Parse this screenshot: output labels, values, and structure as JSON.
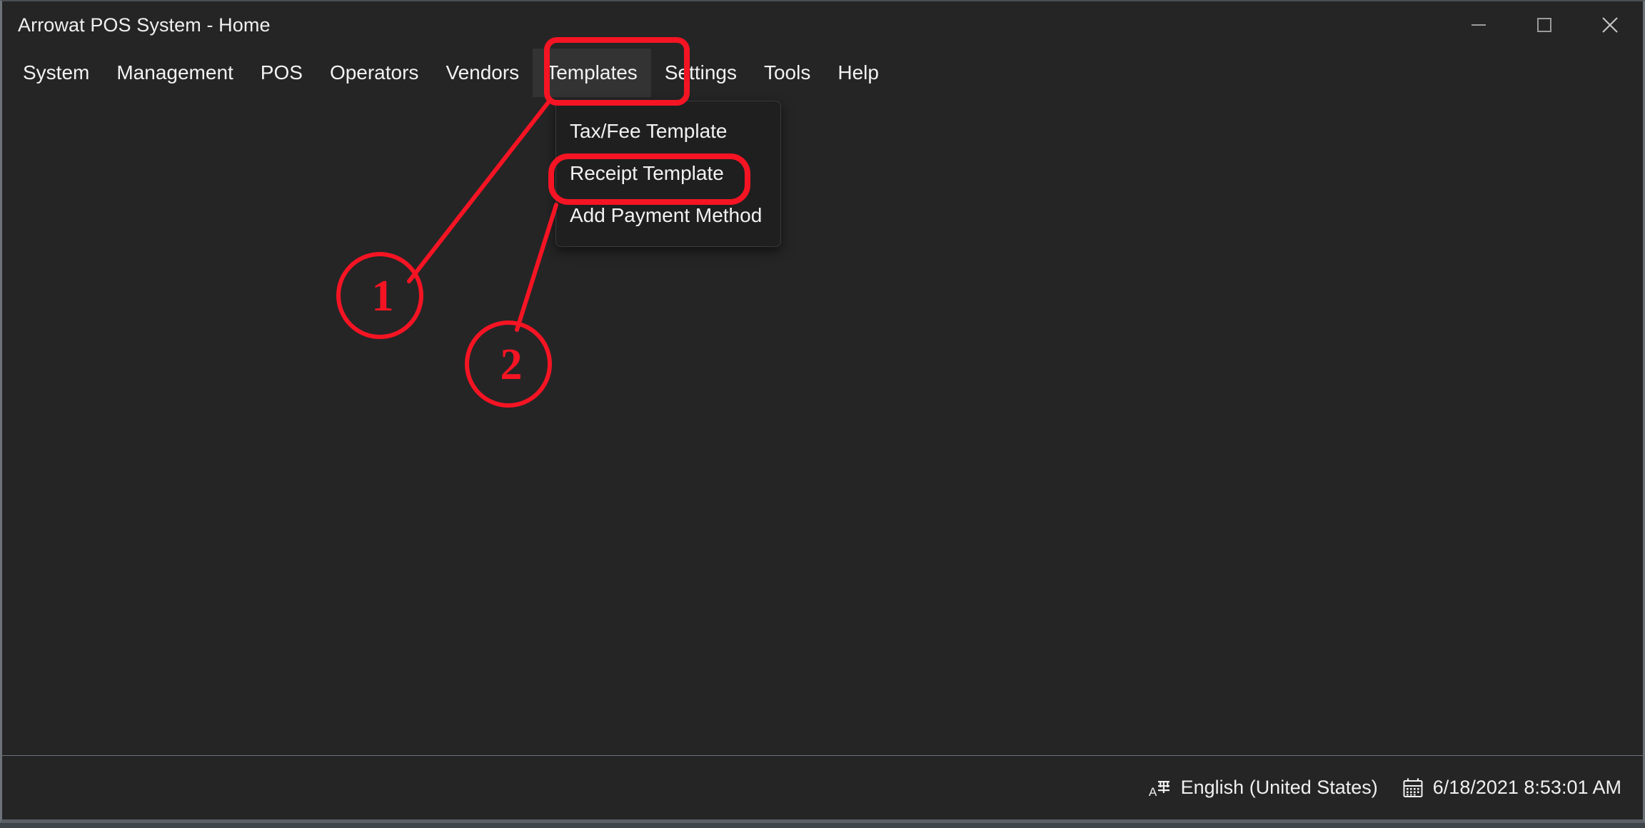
{
  "window": {
    "title": "Arrowat POS System - Home",
    "controls": [
      {
        "name": "minimize",
        "label": "Minimize"
      },
      {
        "name": "maximize",
        "label": "Maximize"
      },
      {
        "name": "close",
        "label": "Close"
      }
    ]
  },
  "menu_bar": {
    "items": [
      {
        "label": "System",
        "active": false
      },
      {
        "label": "Management",
        "active": false
      },
      {
        "label": "POS",
        "active": false
      },
      {
        "label": "Operators",
        "active": false
      },
      {
        "label": "Vendors",
        "active": false
      },
      {
        "label": "Templates",
        "active": true
      },
      {
        "label": "Settings",
        "active": false
      },
      {
        "label": "Tools",
        "active": false
      },
      {
        "label": "Help",
        "active": false
      }
    ]
  },
  "dropdown": {
    "owner": "Templates",
    "items": [
      {
        "label": "Tax/Fee Template",
        "highlighted": false
      },
      {
        "label": "Receipt Template",
        "highlighted": true
      },
      {
        "label": "Add Payment Method",
        "highlighted": false
      }
    ]
  },
  "status_bar": {
    "language": {
      "icon": "ime-language-icon",
      "glyph": "A字",
      "label": "English (United States)"
    },
    "datetime": {
      "icon": "calendar-icon",
      "label": "6/18/2021 8:53:01 AM"
    }
  },
  "annotations": {
    "accent_color": "#f51423",
    "callouts": [
      {
        "number": "1",
        "target": "Templates menu button"
      },
      {
        "number": "2",
        "target": "Receipt Template menu item"
      }
    ]
  }
}
